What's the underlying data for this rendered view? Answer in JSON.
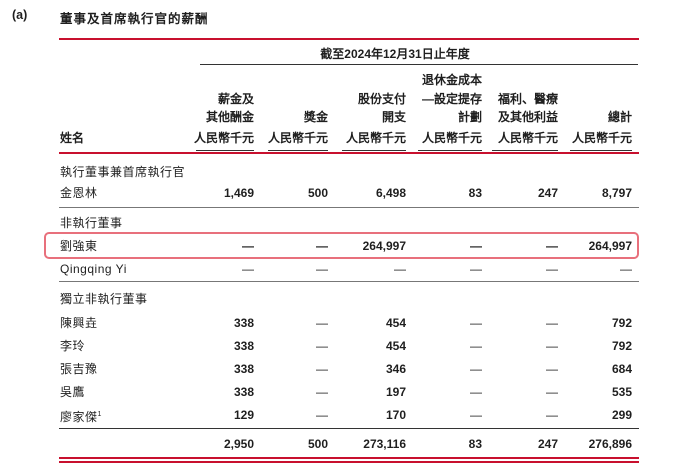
{
  "heading": {
    "label": "(a)",
    "title": "董事及首席執行官的薪酬"
  },
  "table": {
    "period_header": "截至2024年12月31日止年度",
    "name_header": "姓名",
    "columns": [
      {
        "line1": "",
        "line2": "",
        "line3": "",
        "line4": ""
      },
      {
        "line1": "",
        "line2": "薪金及",
        "line3": "其他酬金",
        "line4": "人民幣千元"
      },
      {
        "line1": "",
        "line2": "",
        "line3": "獎金",
        "line4": "人民幣千元"
      },
      {
        "line1": "",
        "line2": "股份支付",
        "line3": "開支",
        "line4": "人民幣千元"
      },
      {
        "line1": "退休金成本",
        "line2": "—設定提存",
        "line3": "計劃",
        "line4": "人民幣千元"
      },
      {
        "line1": "",
        "line2": "福利、醫療",
        "line3": "及其他利益",
        "line4": "人民幣千元"
      },
      {
        "line1": "",
        "line2": "",
        "line3": "總計",
        "line4": "人民幣千元"
      }
    ],
    "group_exec": "執行董事兼首席執行官",
    "group_nonexec": "非執行董事",
    "group_indep": "獨立非執行董事",
    "rows": {
      "jin": {
        "name": "金恩林",
        "values": [
          "1,469",
          "500",
          "6,498",
          "83",
          "247",
          "8,797"
        ]
      },
      "liu": {
        "name": "劉強東",
        "values": [
          "—",
          "—",
          "264,997",
          "—",
          "—",
          "264,997"
        ]
      },
      "qingqing": {
        "name": "Qingqing Yi",
        "values": [
          "—",
          "—",
          "—",
          "—",
          "—",
          "—"
        ]
      },
      "chen": {
        "name": "陳興垚",
        "values": [
          "338",
          "—",
          "454",
          "—",
          "—",
          "792"
        ]
      },
      "li": {
        "name": "李玲",
        "values": [
          "338",
          "—",
          "454",
          "—",
          "—",
          "792"
        ]
      },
      "zhang": {
        "name": "張吉豫",
        "values": [
          "338",
          "—",
          "346",
          "—",
          "—",
          "684"
        ]
      },
      "wu": {
        "name": "吳鷹",
        "values": [
          "338",
          "—",
          "197",
          "—",
          "—",
          "535"
        ]
      },
      "liao": {
        "name": "廖家傑",
        "footnote": "1",
        "values": [
          "129",
          "—",
          "170",
          "—",
          "—",
          "299"
        ]
      }
    },
    "total": {
      "values": [
        "2,950",
        "500",
        "273,116",
        "83",
        "247",
        "276,896"
      ]
    }
  },
  "colors": {
    "accent_red": "#c8102e",
    "highlight_border": "#e8707c"
  }
}
